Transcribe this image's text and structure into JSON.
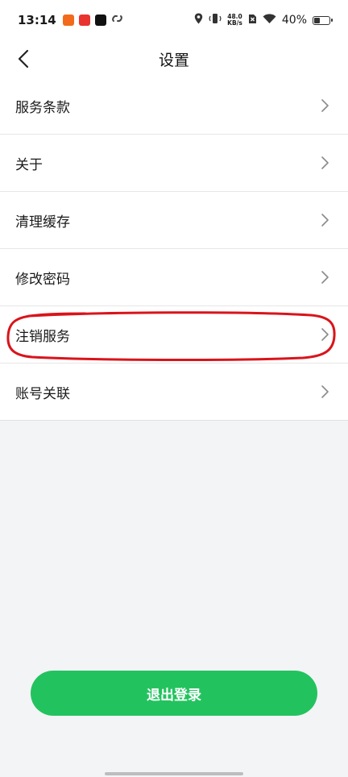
{
  "status_bar": {
    "time": "13:14",
    "app_icons": [
      "shopping-app-icon",
      "news-app-icon",
      "tiktok-icon",
      "link-app-icon"
    ],
    "net_speed_value": "48.0",
    "net_speed_unit": "KB/s",
    "battery_percent": "40%",
    "battery_level": 0.4
  },
  "header": {
    "title": "设置",
    "back_icon": "chevron-left-icon"
  },
  "settings_list": {
    "items": [
      {
        "label": "服务条款"
      },
      {
        "label": "关于"
      },
      {
        "label": "清理缓存"
      },
      {
        "label": "修改密码"
      },
      {
        "label": "注销服务"
      },
      {
        "label": "账号关联"
      }
    ]
  },
  "highlight": {
    "target": "注销服务",
    "color": "#d9141b"
  },
  "logout": {
    "label": "退出登录",
    "color": "#22c35e"
  }
}
